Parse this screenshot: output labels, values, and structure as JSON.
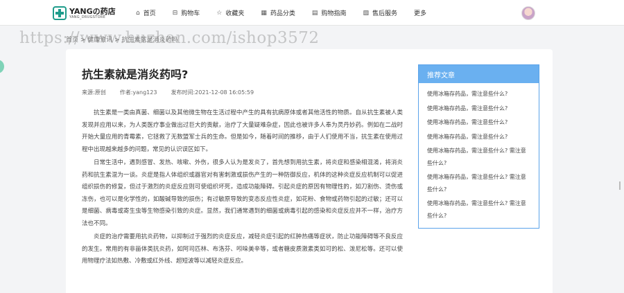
{
  "header": {
    "logo_title": "YANGの药店",
    "logo_sub": "YANG_DRUGSTORE",
    "nav": [
      {
        "icon": "home-icon",
        "glyph": "⌂",
        "label": "首页"
      },
      {
        "icon": "cart-icon",
        "glyph": "⊟",
        "label": "购物车"
      },
      {
        "icon": "star-icon",
        "glyph": "☆",
        "label": "收藏夹"
      },
      {
        "icon": "grid-icon",
        "glyph": "▦",
        "label": "药品分类"
      },
      {
        "icon": "guide-icon",
        "glyph": "▤",
        "label": "购物指南"
      },
      {
        "icon": "service-icon",
        "glyph": "▧",
        "label": "售后服务"
      },
      {
        "icon": "",
        "glyph": "",
        "label": "更多"
      }
    ]
  },
  "watermark": "https://www.huzhan.com/ishop3572",
  "breadcrumb": "首页 > 健康资讯 > 抗生素就是消炎药吗",
  "article": {
    "title": "抗生素就是消炎药吗?",
    "source": "来源:原创",
    "author": "作者:yang123",
    "time": "发布时间:2021-12-08 16:05:59",
    "paragraphs": [
      "抗生素是一类由真菌、细菌以及其他微生物在生活过程中产生的具有抗病原体或者其他活性的物质。自从抗生素被人类发现并应用以来，为人类医疗事业做出过巨大的贡献，治疗了大量疑难杂症，因此也被许多人奉为灵丹妙药。例如在二战时开始大量应用的青霉素，它拯救了无数盟军士兵的生命。但是如今，随着时间的推移，由于人们使用不当，抗生素在使用过程中出现越来越多的问题，常见的认识误区如下。",
      "日常生活中，遇到感冒、发热、咳嗽、外伤，很多人认为是发炎了，首先想到用抗生素，将炎症和感染相混淆，将消炎药和抗生素混为一谈。炎症是指人体组织或器官对有害刺激或损伤产生的一种防御反应，机体的这种炎症反应机制可以促进组织损伤的修复，但过于激烈的炎症反应则可使组织坏死，造成功能障碍。引起炎症的原因有物理性的，如刀割伤、烫伤或冻伤，也可以是化学性的，如酸碱导致的损伤；有过敏原导致的变态反应性炎症，如花粉、食物或药物引起的过敏；还可以是细菌、病毒或寄生虫等生物感染引致的炎症。显然，我们通常遇到的细菌或病毒引起的感染和炎症反应并不一样，治疗方法也不同。",
      "炎症的治疗需要用抗炎药物，以抑制过于强烈的炎症反应，减轻炎症引起的红肿热痛等症状，防止功能障碍等不良反应的发生。常用的有非甾体类抗炎药，如阿司匹林、布洛芬、吲哚美辛等，或者糖皮质激素类如可的松、泼尼松等。还可以使用物理疗法如热敷、冷敷或红外线、超短波等以减轻炎症反应。"
    ]
  },
  "sidebar": {
    "title": "推荐文章",
    "items": [
      "使用冰箱存药品，需注意些什么?",
      "使用冰箱存药品，需注意些什么?",
      "使用冰箱存药品，需注意些什么?",
      "使用冰箱存药品，需注意些什么?",
      "使用冰箱存药品，需注意些什么? 需注意些什么?",
      "使用冰箱存药品，需注意些什么? 需注意些什么?",
      "使用冰箱存药品，需注意些什么? 需注意些什么?"
    ]
  }
}
